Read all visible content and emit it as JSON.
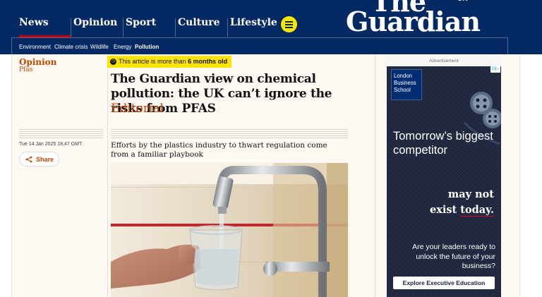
{
  "nav": {
    "pillars": [
      "News",
      "Opinion",
      "Sport",
      "Culture",
      "Lifestyle"
    ],
    "subnav": [
      "Environment",
      "Climate crisis",
      "Wildlife",
      "Energy",
      "Pollution"
    ]
  },
  "brand": {
    "logo_top": "The",
    "logo_bottom": "Guardian",
    "edition": "UK"
  },
  "article": {
    "section": "Opinion",
    "series": "Pfas",
    "age_badge_prefix": "This article is more than",
    "age_badge_bold": "6 months old",
    "headline": "The Guardian view on chemical pollution: the UK can’t ignore the risks from PFAS",
    "kicker": "Editorial",
    "standfirst": "Efforts by the plastics industry to thwart regulation come from a familiar playbook",
    "dateline": "Tue 14 Jan 2025 18.47 GMT",
    "share_label": "Share"
  },
  "ad": {
    "label": "Advertisement",
    "logo_text": "London Business School",
    "headline": "Tomorrow’s biggest competitor",
    "line1": "may not",
    "line2a": "exist",
    "line2b": "today.",
    "body": "Are your leaders ready to unlock the future of your business?",
    "cta": "Explore Executive Education",
    "corner": "D|▷"
  },
  "colors": {
    "brand_blue": "#052962",
    "opinion_orange": "#c74600",
    "highlight_yellow": "#ffe500",
    "nav_red": "#c70000"
  },
  "icons": {
    "menu": "hamburger-icon",
    "share": "share-icon",
    "clock": "clock-icon"
  }
}
